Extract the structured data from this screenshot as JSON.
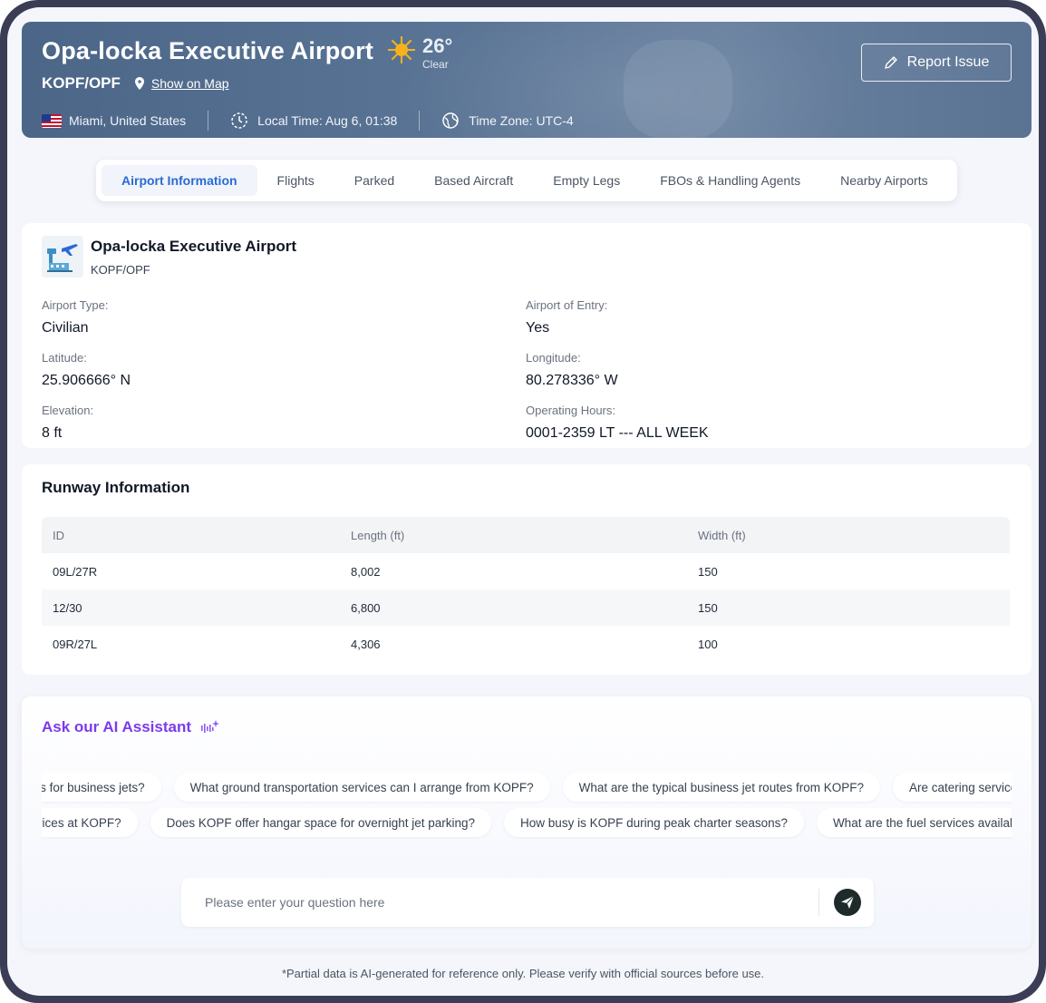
{
  "header": {
    "airport_name": "Opa-locka Executive Airport",
    "code": "KOPF/OPF",
    "show_on_map": "Show on Map",
    "weather": {
      "temp": "26°",
      "condition": "Clear",
      "icon": "sun-icon"
    },
    "location": "Miami, United States",
    "local_time": "Local Time: Aug 6, 01:38",
    "time_zone": "Time Zone: UTC-4",
    "report_button": "Report Issue"
  },
  "tabs": [
    {
      "label": "Airport Information",
      "active": true
    },
    {
      "label": "Flights"
    },
    {
      "label": "Parked"
    },
    {
      "label": "Based Aircraft"
    },
    {
      "label": "Empty Legs"
    },
    {
      "label": "FBOs & Handling Agents"
    },
    {
      "label": "Nearby Airports"
    }
  ],
  "airport_info": {
    "name": "Opa-locka Executive Airport",
    "code": "KOPF/OPF",
    "fields": {
      "type_label": "Airport Type:",
      "type_value": "Civilian",
      "entry_label": "Airport of Entry:",
      "entry_value": "Yes",
      "lat_label": "Latitude:",
      "lat_value": "25.906666° N",
      "lon_label": "Longitude:",
      "lon_value": "80.278336° W",
      "elev_label": "Elevation:",
      "elev_value": "8 ft",
      "hours_label": "Operating Hours:",
      "hours_value": "0001-2359 LT --- ALL WEEK"
    }
  },
  "runway": {
    "title": "Runway Information",
    "columns": [
      "ID",
      "Length (ft)",
      "Width (ft)"
    ],
    "rows": [
      [
        "09L/27R",
        "8,002",
        "150"
      ],
      [
        "12/30",
        "6,800",
        "150"
      ],
      [
        "09R/27L",
        "4,306",
        "100"
      ]
    ]
  },
  "ai": {
    "title": "Ask our AI Assistant",
    "chips_row1": [
      "What are the best options for business jets?",
      "What ground transportation services can I arrange from KOPF?",
      "What are the typical business jet routes from KOPF?",
      "Are catering services available?"
    ],
    "chips_row2": [
      "What are the customs services at KOPF?",
      "Does KOPF offer hangar space for overnight jet parking?",
      "How busy is KOPF during peak charter seasons?",
      "What are the fuel services available?"
    ],
    "placeholder": "Please enter your question here"
  },
  "disclaimer": "*Partial data is AI-generated for reference only. Please verify with official sources before use.",
  "colors": {
    "accent": "#2a6ad6",
    "ai_purple": "#7c3aed",
    "header": "#4c6688"
  }
}
